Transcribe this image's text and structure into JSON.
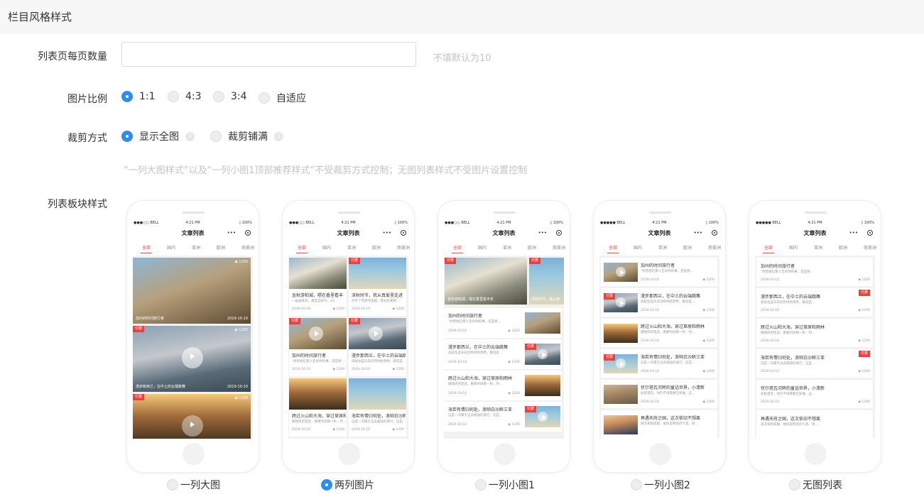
{
  "header": {
    "title": "栏目风格样式"
  },
  "page_size": {
    "label": "列表页每页数量",
    "value": "",
    "placeholder": "",
    "hint": "不填默认为10"
  },
  "image_ratio": {
    "label": "图片比例",
    "options": [
      "1:1",
      "4:3",
      "3:4",
      "自适应"
    ],
    "selected": "1:1"
  },
  "crop_mode": {
    "label": "裁剪方式",
    "options": [
      "显示全图",
      "裁剪铺满"
    ],
    "selected": "显示全图",
    "info_icon": "info-icon"
  },
  "notice": "“一列大图样式”以及“一列小图1顶部推荐样式”不受裁剪方式控制；无图列表样式不受图片设置控制",
  "list_style": {
    "label": "列表板块样式",
    "options": [
      "一列大图",
      "两列图片",
      "一列小图1",
      "一列小图2",
      "无图列表"
    ],
    "selected": "两列图片"
  },
  "phone": {
    "carrier": "●●●○○ BELL",
    "carrier_alt": "●●●●● BELL",
    "time": "4:21 PM",
    "battery": "▯ 100%",
    "title": "文章列表",
    "menu_glyph": "•••",
    "tabs": [
      "全部",
      "国内",
      "亚洲",
      "欧洲",
      "南美洲"
    ],
    "badge_paid": "付费",
    "date": "2019-10-10",
    "views": "◉ 1200",
    "views_top": "◉ 1200",
    "articles": [
      {
        "title": "加州的时间旅行者",
        "sub": "\"你曾相信那人告诉你的事，还是想…"
      },
      {
        "title": "漫步那西兰，在中土的云端跳舞",
        "sub": "再就住蓝天白云和绿色草原，都说是…"
      },
      {
        "title": "跨过火山和大海，穿过草原和雨林",
        "sub": "跟随风的足迹，看那时间那一秒，时…"
      },
      {
        "title": "海若有情归何处，浪响白沙醉三亚",
        "sub": "这是一次属于远去孤独的旅行，这是…"
      },
      {
        "title": "伏尔塔瓦河畔的童话世界，小清新",
        "sub": "此程漫无，你仍不再需要告知谁，这…"
      },
      {
        "title": "再遇天府之国，这次依旧不想离",
        "sub": "再次来到成都，依旧是熟悉的气息，依…"
      }
    ],
    "big_caption_1": "加州的时间旅行者",
    "big_caption_2": "漫步新西兰，在中土的云端跳舞",
    "grid_cap1": "金秋游柏城，唱在香里看丰",
    "grid_cap2": "深秋时节，我从真爱里走进",
    "grid_sub1": "一画画看去，真是自如今。21…",
    "grid_sub2": "深乎了完善的旅题，我总有要那…",
    "top_cap1": "金秋游柏城，唱在香里看丰年",
    "top_cap2": "深秋时节，我从两"
  }
}
